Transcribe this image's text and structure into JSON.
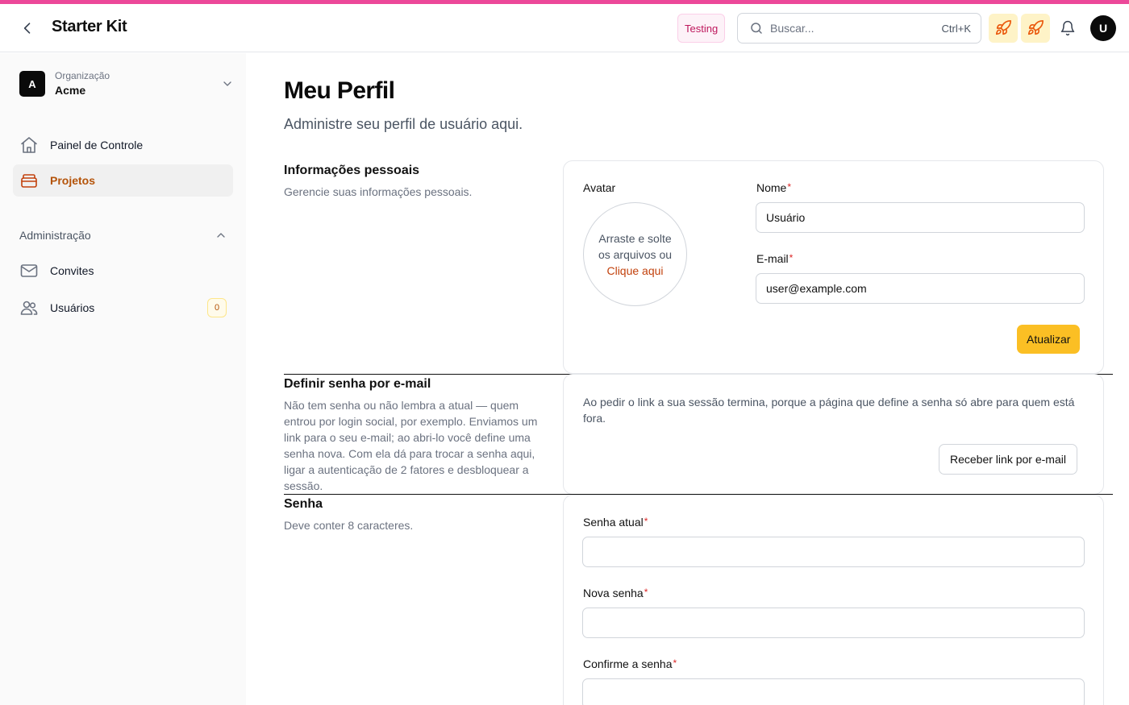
{
  "header": {
    "title": "Starter Kit",
    "env_badge": "Testing",
    "search_placeholder": "Buscar...",
    "search_shortcut": "Ctrl+K",
    "avatar_initial": "U"
  },
  "sidebar": {
    "org": {
      "label": "Organização",
      "name": "Acme",
      "logo_initial": "A"
    },
    "items": [
      {
        "label": "Painel de Controle",
        "icon": "home-icon",
        "active": false
      },
      {
        "label": "Projetos",
        "icon": "folder-icon",
        "active": true
      }
    ],
    "section": {
      "label": "Administração",
      "items": [
        {
          "label": "Convites",
          "icon": "mail-icon"
        },
        {
          "label": "Usuários",
          "icon": "users-icon",
          "count": "0"
        }
      ]
    }
  },
  "page": {
    "title": "Meu Perfil",
    "subtitle": "Administre seu perfil de usuário aqui."
  },
  "personal": {
    "title": "Informações pessoais",
    "description": "Gerencie suas informações pessoais.",
    "avatar_label": "Avatar",
    "avatar_drop_text": "Arraste e solte os arquivos ou",
    "avatar_drop_link": "Clique aqui",
    "name_label": "Nome",
    "name_value": "Usuário",
    "email_label": "E-mail",
    "email_value": "user@example.com",
    "submit_label": "Atualizar"
  },
  "email_password": {
    "title": "Definir senha por e-mail",
    "description": "Não tem senha ou não lembra a atual — quem entrou por login social, por exemplo. Enviamos um link para o seu e-mail; ao abri-lo você define uma senha nova. Com ela dá para trocar a senha aqui, ligar a autenticação de 2 fatores e desbloquear a sessão.",
    "card_text": "Ao pedir o link a sua sessão termina, porque a página que define a senha só abre para quem está fora.",
    "button_label": "Receber link por e-mail"
  },
  "password": {
    "title": "Senha",
    "description": "Deve conter 8 caracteres.",
    "current_label": "Senha atual",
    "new_label": "Nova senha",
    "confirm_label": "Confirme a senha"
  },
  "required_marker": "*",
  "colors": {
    "accent_bar": "#ec4899",
    "brand_active": "#b45309",
    "primary_button": "#fbbf24",
    "required": "#dc2626"
  }
}
